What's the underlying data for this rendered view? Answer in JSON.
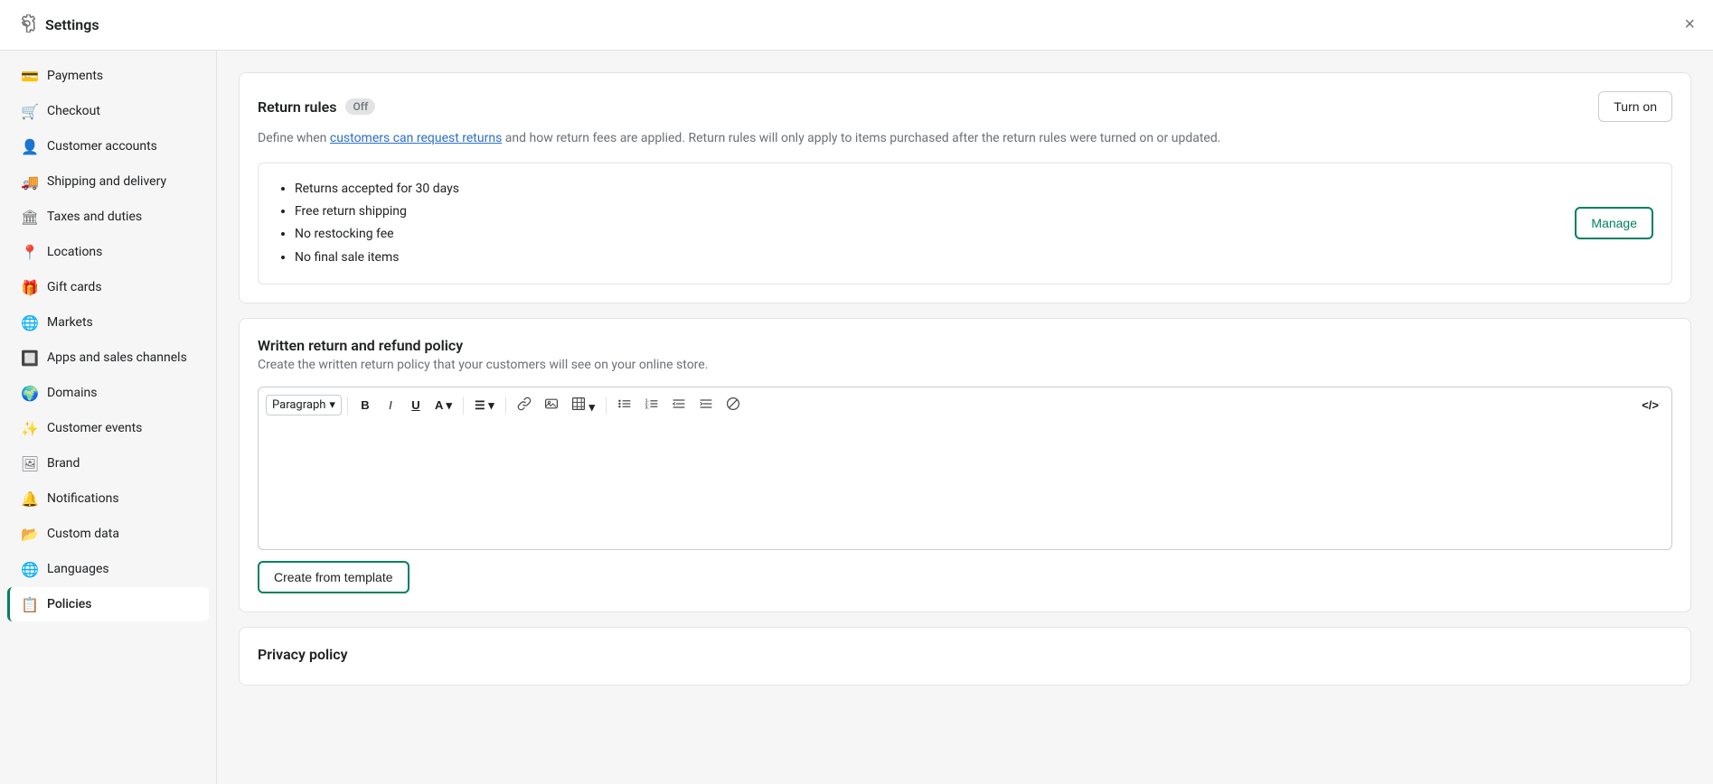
{
  "app": {
    "title": "Settings",
    "close_label": "×"
  },
  "sidebar": {
    "items": [
      {
        "id": "payments",
        "label": "Payments",
        "icon": "💳"
      },
      {
        "id": "checkout",
        "label": "Checkout",
        "icon": "🛒"
      },
      {
        "id": "customer-accounts",
        "label": "Customer accounts",
        "icon": "👤"
      },
      {
        "id": "shipping",
        "label": "Shipping and delivery",
        "icon": "🚚"
      },
      {
        "id": "taxes",
        "label": "Taxes and duties",
        "icon": "🏛"
      },
      {
        "id": "locations",
        "label": "Locations",
        "icon": "📍"
      },
      {
        "id": "gift-cards",
        "label": "Gift cards",
        "icon": "🎁"
      },
      {
        "id": "markets",
        "label": "Markets",
        "icon": "🌐"
      },
      {
        "id": "apps",
        "label": "Apps and sales channels",
        "icon": "🔲"
      },
      {
        "id": "domains",
        "label": "Domains",
        "icon": "🌍"
      },
      {
        "id": "customer-events",
        "label": "Customer events",
        "icon": "✨"
      },
      {
        "id": "brand",
        "label": "Brand",
        "icon": "🖼"
      },
      {
        "id": "notifications",
        "label": "Notifications",
        "icon": "🔔"
      },
      {
        "id": "custom-data",
        "label": "Custom data",
        "icon": "📂"
      },
      {
        "id": "languages",
        "label": "Languages",
        "icon": "🌐"
      },
      {
        "id": "policies",
        "label": "Policies",
        "icon": "📋",
        "active": true
      }
    ]
  },
  "return_rules": {
    "title": "Return rules",
    "badge": "Off",
    "description_before_link": "Define when ",
    "link_text": "customers can request returns",
    "description_after_link": " and how return fees are applied. Return rules will only apply to items purchased after the return rules were turned on or updated.",
    "turn_on_label": "Turn on",
    "rules": [
      "Returns accepted for 30 days",
      "Free return shipping",
      "No restocking fee",
      "No final sale items"
    ],
    "manage_label": "Manage"
  },
  "written_policy": {
    "title": "Written return and refund policy",
    "description": "Create the written return policy that your customers will see on your online store.",
    "toolbar": {
      "paragraph_label": "Paragraph",
      "bold": "B",
      "italic": "I",
      "underline": "U",
      "font_color": "A",
      "align": "≡",
      "link": "🔗",
      "media": "⊡",
      "table": "⊞",
      "bullet_list": "≡",
      "ordered_list": "≡",
      "indent_decrease": "≡",
      "indent_increase": "≡",
      "clear": "⊘",
      "code": "</>",
      "chevron_down": "▾"
    },
    "create_template_label": "Create from template"
  },
  "privacy_policy": {
    "title": "Privacy policy"
  }
}
